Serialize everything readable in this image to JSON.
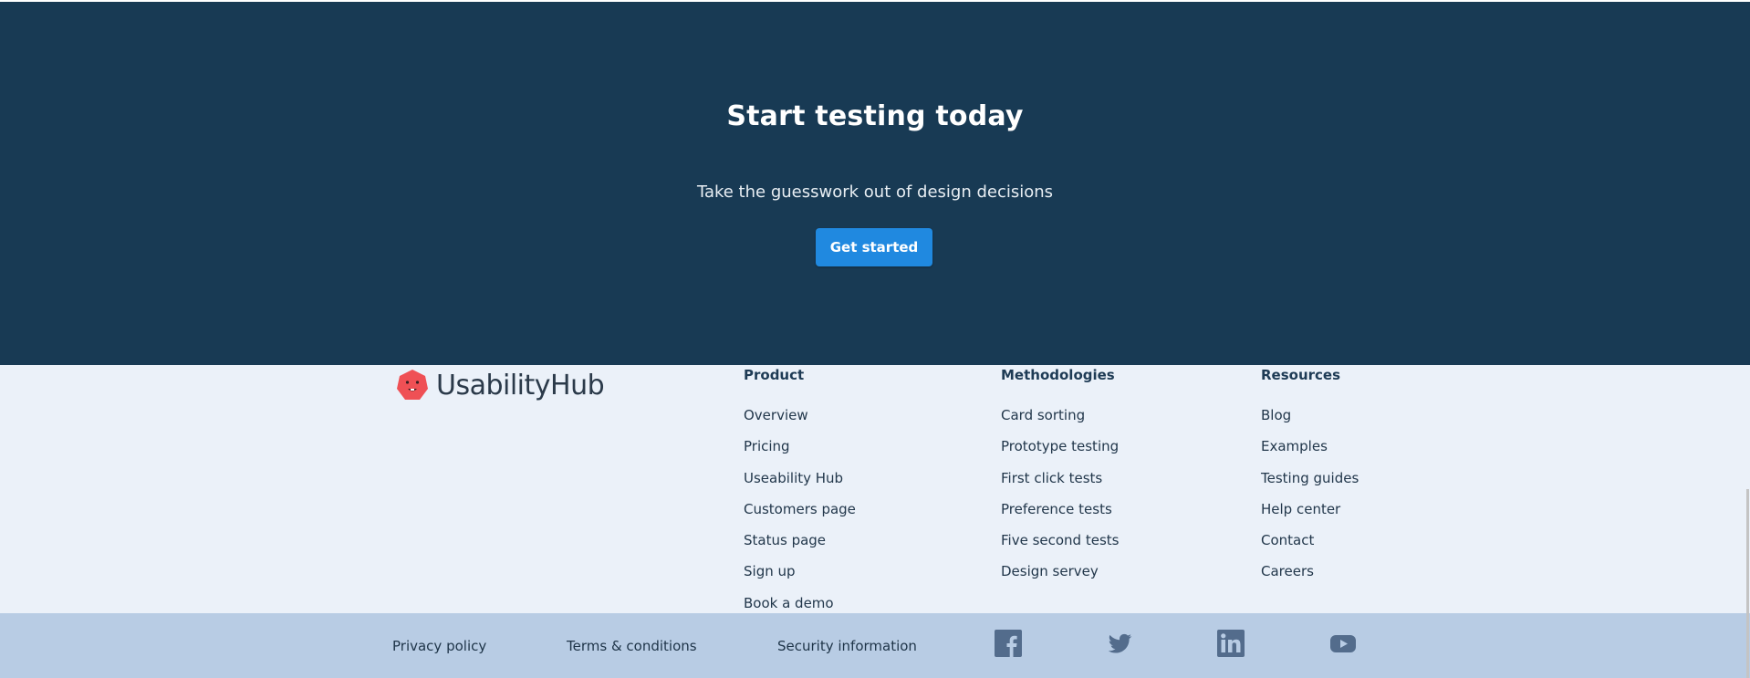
{
  "cta": {
    "title": "Start testing today",
    "subtitle": "Take the guesswork out of design decisions",
    "button_label": "Get started",
    "background": "#183a54",
    "button_color": "#2089e0"
  },
  "brand": {
    "name": "UsabilityHub",
    "logo_color": "#ef5055",
    "logo_icon": "hexagon-face-logo"
  },
  "columns": [
    {
      "heading": "Product",
      "items": [
        "Overview",
        "Pricing",
        "Useability Hub",
        "Customers page",
        "Status page",
        "Sign up",
        "Book a demo"
      ]
    },
    {
      "heading": "Methodologies",
      "items": [
        "Card sorting",
        "Prototype testing",
        "First click tests",
        "Preference tests",
        "Five second tests",
        "Design servey"
      ]
    },
    {
      "heading": "Resources",
      "items": [
        "Blog",
        "Examples",
        "Testing guides",
        "Help center",
        "Contact",
        "Careers"
      ]
    }
  ],
  "legal": {
    "privacy": "Privacy policy",
    "terms": "Terms & conditions",
    "security": "Security information"
  },
  "social": [
    {
      "icon": "facebook-icon"
    },
    {
      "icon": "twitter-icon"
    },
    {
      "icon": "linkedin-icon"
    },
    {
      "icon": "youtube-icon"
    }
  ],
  "colors": {
    "footer_background": "#ebf1f9",
    "bottom_bar_background": "#b8cce4",
    "social_icon_color": "#536c8c"
  }
}
